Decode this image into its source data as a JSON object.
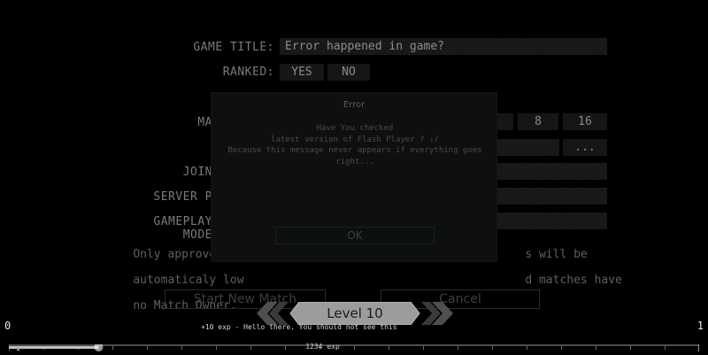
{
  "form": {
    "game_title_label": "GAME TITLE:",
    "game_title_value": "Error happened in game?",
    "ranked_label": "RANKED:",
    "ranked_yes": "YES",
    "ranked_no": "NO",
    "max_label_partial": "MA",
    "max_option_8": "8",
    "max_option_16": "16",
    "browse_button": "...",
    "join_label_partial": "JOIN",
    "server_label_partial": "SERVER P",
    "gameplay_label_partial": "GAMEPLAY MODE",
    "note_line1": "Only approved map",
    "note_line1_tail": "s will be",
    "note_line2": "automaticaly low",
    "note_line2_tail": "d matches have",
    "note_line3": "no Match Owner.",
    "start_button": "Start New Match",
    "cancel_button": "Cancel"
  },
  "dialog": {
    "title": "Error",
    "message_line1": "Have You checked",
    "message_line2": "latest version of Flash Player ? :/",
    "message_line3": "Because this message never appears if everything goes",
    "message_line4": "right...",
    "ok_button": "OK"
  },
  "hud": {
    "level_label": "Level 10",
    "xp_message": "+10 exp - Hello there. You should not see this",
    "xp_start": "0",
    "xp_end": "1",
    "xp_total": "1234 exp",
    "xp_progress": 0.13
  },
  "colors": {
    "background": "#000000",
    "level_badge": "#9a9a9a",
    "level_arrows": "#5a5a5a"
  }
}
